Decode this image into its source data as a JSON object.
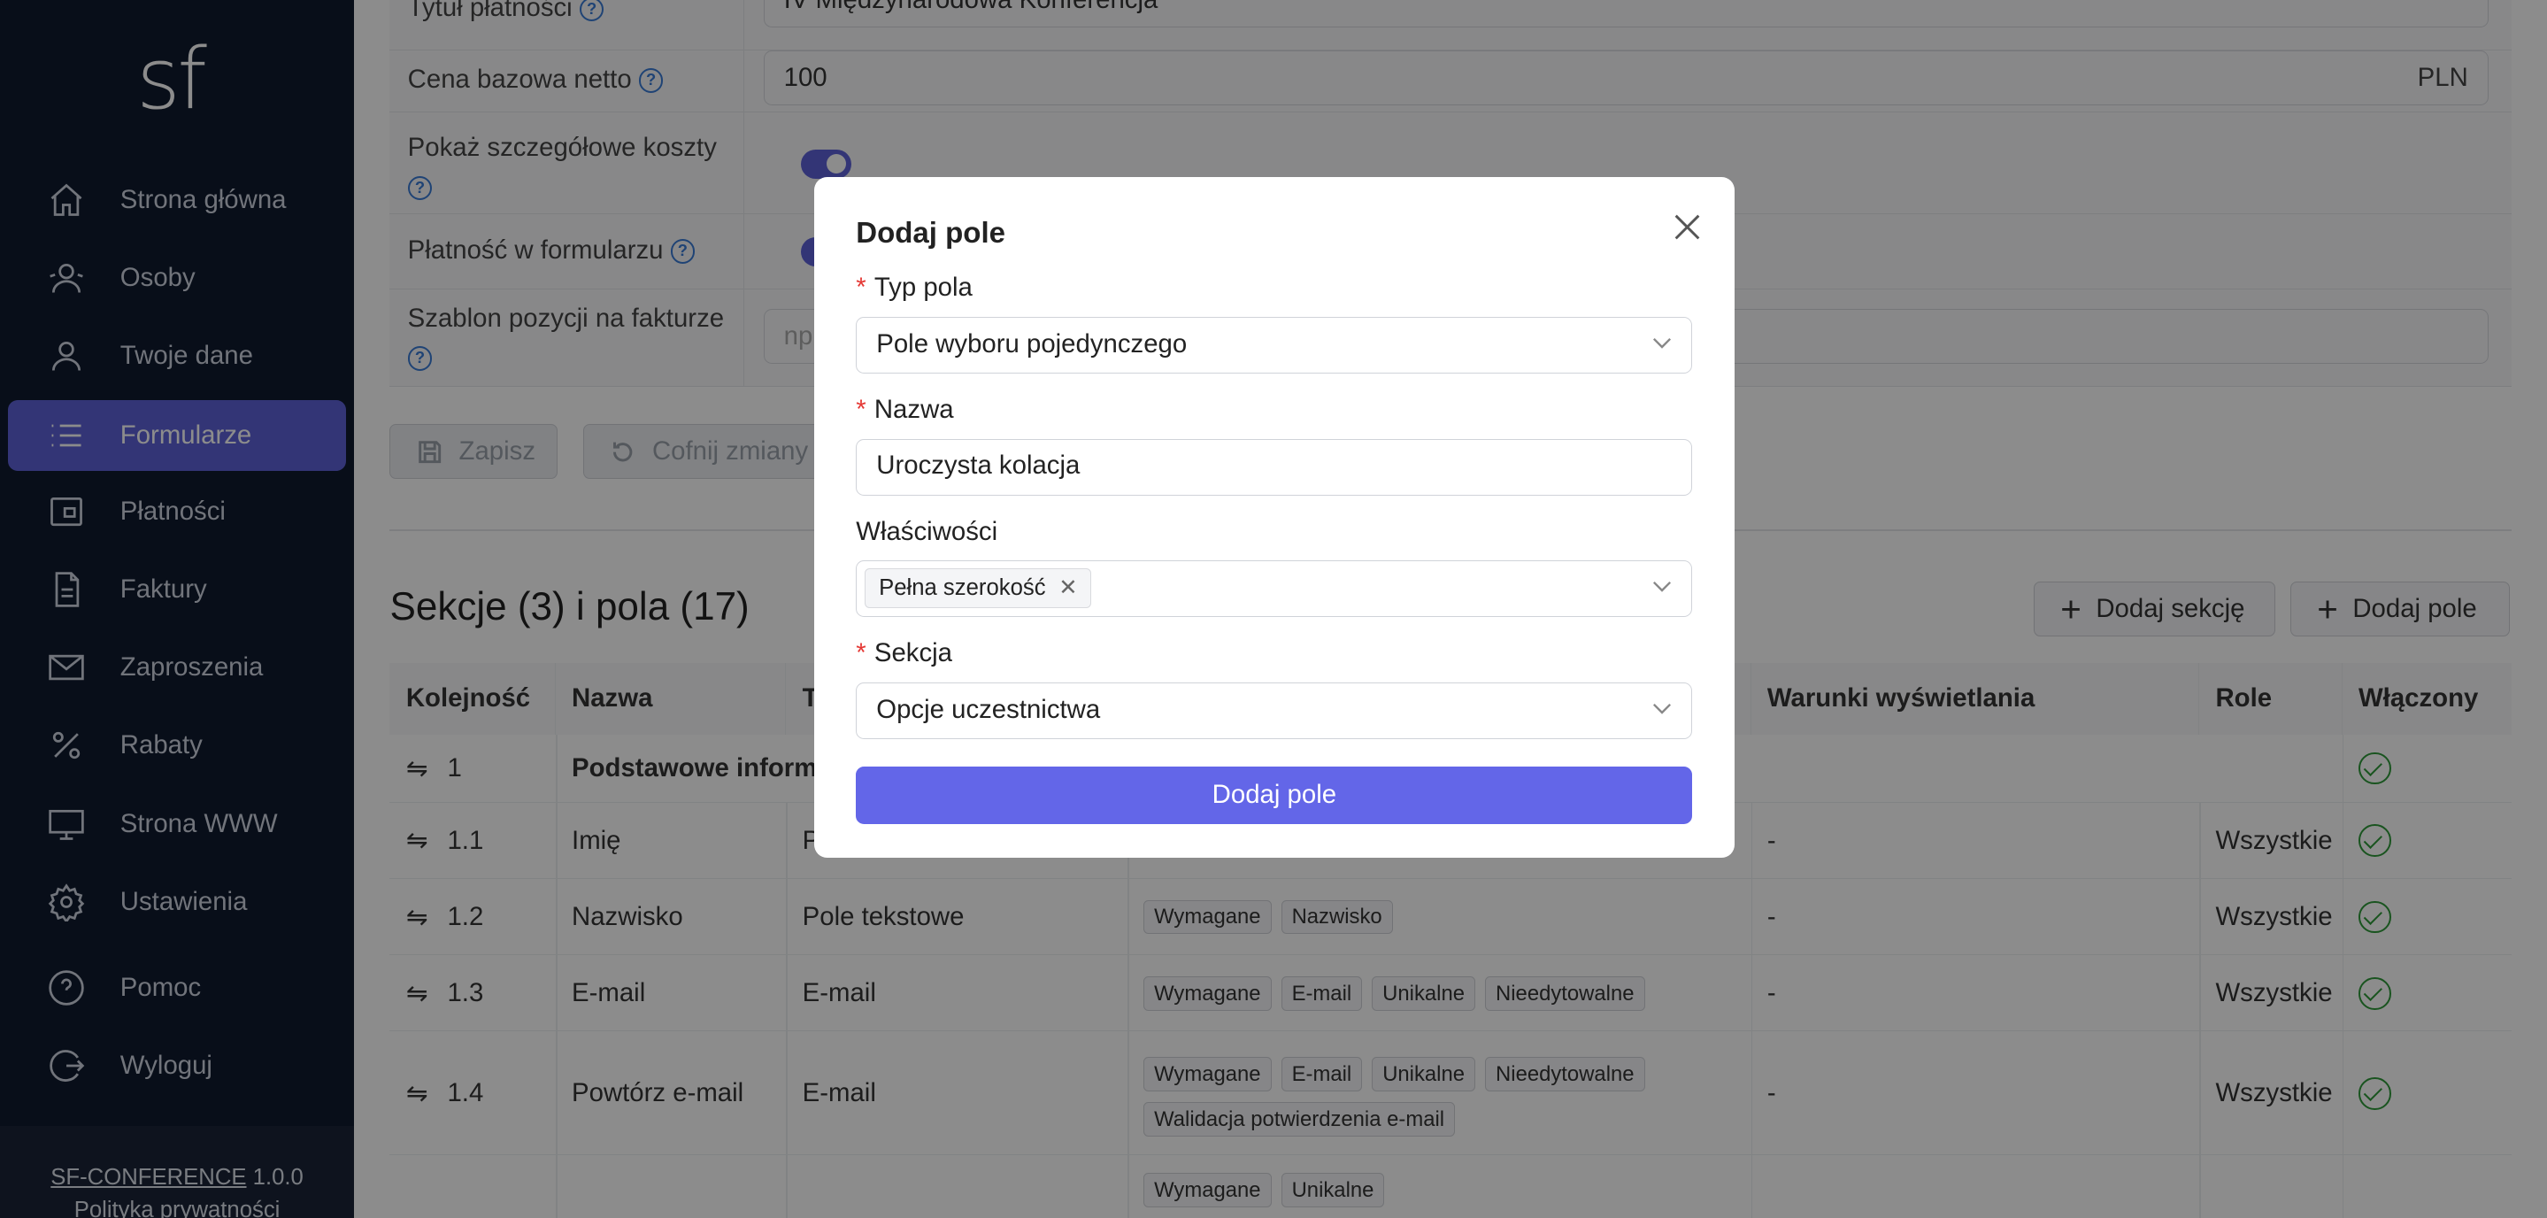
{
  "sidebar": {
    "logo": "sf",
    "items": [
      {
        "label": "Strona główna",
        "icon": "home-icon"
      },
      {
        "label": "Osoby",
        "icon": "users-icon"
      },
      {
        "label": "Twoje dane",
        "icon": "user-icon"
      },
      {
        "label": "Formularze",
        "icon": "list-icon",
        "active": true
      },
      {
        "label": "Płatności",
        "icon": "wallet-icon"
      },
      {
        "label": "Faktury",
        "icon": "document-icon"
      },
      {
        "label": "Zaproszenia",
        "icon": "mail-icon"
      },
      {
        "label": "Rabaty",
        "icon": "percent-icon"
      },
      {
        "label": "Strona WWW",
        "icon": "monitor-icon"
      },
      {
        "label": "Ustawienia",
        "icon": "gear-icon"
      },
      {
        "label": "Pomoc",
        "icon": "help-icon"
      },
      {
        "label": "Wyloguj",
        "icon": "logout-icon"
      }
    ],
    "footer": {
      "app_name": "SF-CONFERENCE",
      "version": "1.0.0",
      "privacy": "Polityka prywatności"
    }
  },
  "form": {
    "title_label": "Tytuł płatności",
    "title_value": "IV Międzynarodowa Konferencja",
    "price_label": "Cena bazowa netto",
    "price_value": "100",
    "price_currency": "PLN",
    "show_costs_label": "Pokaż szczegółowe koszty",
    "payment_in_form_label": "Płatność w formularzu",
    "invoice_template_label": "Szablon pozycji na fakturze",
    "invoice_template_placeholder": "np",
    "save_label": "Zapisz",
    "revert_label": "Cofnij zmiany"
  },
  "sections": {
    "heading": "Sekcje (3) i pola (17)",
    "add_section_label": "Dodaj sekcję",
    "add_field_label": "Dodaj pole"
  },
  "table": {
    "columns": [
      "Kolejność",
      "Nazwa",
      "T",
      "Warunki wyświetlania",
      "Role",
      "Włączony"
    ],
    "rows": [
      {
        "order": "1",
        "name": "Podstawowe inform",
        "type": "",
        "tags": [],
        "conditions": "",
        "roles": "",
        "enabled": true,
        "bold": true
      },
      {
        "order": "1.1",
        "name": "Imię",
        "type": "P",
        "tags": [],
        "conditions": "-",
        "roles": "Wszystkie",
        "enabled": true
      },
      {
        "order": "1.2",
        "name": "Nazwisko",
        "type": "Pole tekstowe",
        "tags": [
          "Wymagane",
          "Nazwisko"
        ],
        "conditions": "-",
        "roles": "Wszystkie",
        "enabled": true
      },
      {
        "order": "1.3",
        "name": "E-mail",
        "type": "E-mail",
        "tags": [
          "Wymagane",
          "E-mail",
          "Unikalne",
          "Nieedytowalne"
        ],
        "conditions": "-",
        "roles": "Wszystkie",
        "enabled": true
      },
      {
        "order": "1.4",
        "name": "Powtórz e-mail",
        "type": "E-mail",
        "tags": [
          "Wymagane",
          "E-mail",
          "Unikalne",
          "Nieedytowalne",
          "Walidacja potwierdzenia e-mail"
        ],
        "conditions": "-",
        "roles": "Wszystkie",
        "enabled": true
      },
      {
        "order": "",
        "name": "",
        "type": "",
        "tags": [
          "Wymagane",
          "Unikalne"
        ],
        "conditions": "",
        "roles": "",
        "enabled": false
      }
    ]
  },
  "modal": {
    "title": "Dodaj pole",
    "field_type_label": "Typ pola",
    "field_type_value": "Pole wyboru pojedynczego",
    "name_label": "Nazwa",
    "name_value": "Uroczysta kolacja",
    "properties_label": "Właściwości",
    "properties_tag": "Pełna szerokość",
    "section_label": "Sekcja",
    "section_value": "Opcje uczestnictwa",
    "submit_label": "Dodaj pole"
  }
}
